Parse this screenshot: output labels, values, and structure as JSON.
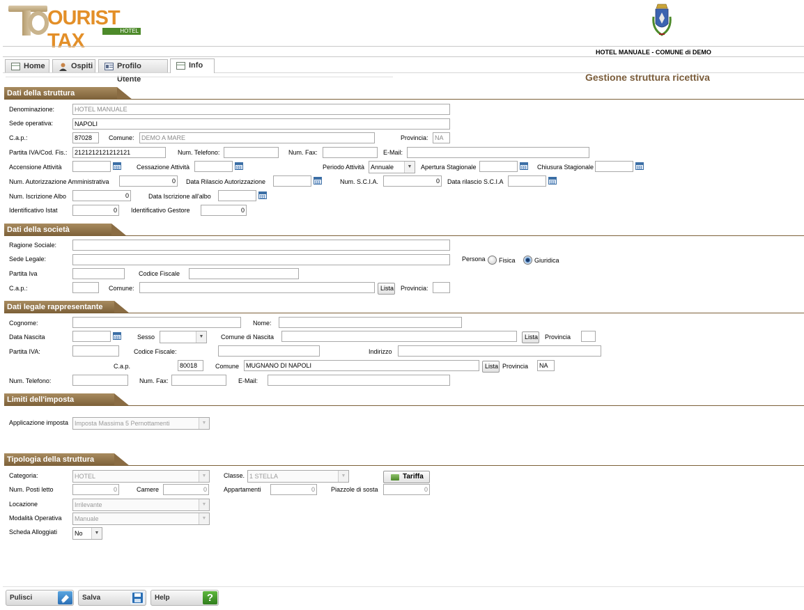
{
  "logo": {
    "text": "OURIST TAX",
    "letter": "T",
    "sub": "HOTEL"
  },
  "header": {
    "title": "HOTEL MANUALE - COMUNE di DEMO",
    "subtitle": "Gestione struttura ricettiva"
  },
  "tabs": [
    {
      "label": "Home",
      "icon": "home-icon"
    },
    {
      "label": "Ospiti",
      "icon": "user-icon"
    },
    {
      "label": "Profilo Utente",
      "icon": "id-card-icon"
    },
    {
      "label": "Info",
      "icon": "info-icon"
    }
  ],
  "colors": {
    "section": "#8a6c43",
    "accent": "#3b6ea5"
  },
  "struttura": {
    "title": "Dati della struttura",
    "denominazione_label": "Denominazione:",
    "denominazione": "HOTEL MANUALE",
    "sede_label": "Sede operativa:",
    "sede": "NAPOLI",
    "cap_label": "C.a.p.:",
    "cap": "87028",
    "comune_label": "Comune:",
    "comune": "DEMO A MARE",
    "provincia_label": "Provincia:",
    "provincia": "NA",
    "piva_label": "Partita IVA/Cod. Fis.:",
    "piva": "2121212121212121",
    "tel_label": "Num. Telefono:",
    "fax_label": "Num. Fax:",
    "email_label": "E-Mail:",
    "accensione_label": "Accensione Attività",
    "cessazione_label": "Cessazione Attività",
    "periodo_label": "Periodo Attività",
    "periodo": "Annuale",
    "apertura_label": "Apertura Stagionale",
    "chiusura_label": "Chiusura Stagionale",
    "aut_label": "Num. Autorizzazione Amministrativa",
    "aut": "0",
    "data_aut_label": "Data Rilascio Autorizzazione",
    "scia_label": "Num. S.C.I.A.",
    "scia": "0",
    "data_scia_label": "Data rilascio S.C.I.A",
    "albo_label": "Num. Iscrizione Albo",
    "albo": "0",
    "data_albo_label": "Data Iscrizione all'albo",
    "istat_label": "Identificativo Istat",
    "istat": "0",
    "gestore_label": "Identificativo Gestore",
    "gestore": "0"
  },
  "societa": {
    "title": "Dati della società",
    "ragione_label": "Ragione Sociale:",
    "sede_label": "Sede Legale:",
    "persona_label": "Persona",
    "fisica_label": "Fisica",
    "giuridica_label": "Giuridica",
    "piva_label": "Partita Iva",
    "cf_label": "Codice Fiscale",
    "cap_label": "C.a.p.:",
    "comune_label": "Comune:",
    "lista_label": "Lista",
    "provincia_label": "Provincia:"
  },
  "legale": {
    "title": "Dati legale rappresentante",
    "cognome_label": "Cognome:",
    "nome_label": "Nome:",
    "nascita_label": "Data Nascita",
    "sesso_label": "Sesso",
    "comune_nascita_label": "Comune di Nascita",
    "lista_label": "Lista",
    "provincia_label": "Provincia",
    "piva_label": "Partita IVA:",
    "cf_label": "Codice Fiscale:",
    "indirizzo_label": "Indirizzo",
    "cap_label": "C.a.p.",
    "cap": "80018",
    "comune_label": "Comune",
    "comune": "MUGNANO DI NAPOLI",
    "provincia2_label": "Provincia",
    "provincia2": "NA",
    "tel_label": "Num. Telefono:",
    "fax_label": "Num. Fax:",
    "email_label": "E-Mail:"
  },
  "limiti": {
    "title": "Limiti dell'imposta",
    "applicazione_label": "Applicazione imposta",
    "applicazione": "Imposta Massima 5 Pernottamenti"
  },
  "tipologia": {
    "title": "Tipologia della struttura",
    "categoria_label": "Categoria:",
    "categoria": "HOTEL",
    "classe_label": "Classe.",
    "classe": "1 STELLA",
    "tariffa_label": "Tariffa",
    "posti_label": "Num. Posti letto",
    "posti": "0",
    "camere_label": "Camere",
    "camere": "0",
    "appartamenti_label": "Appartamenti",
    "appartamenti": "0",
    "piazzole_label": "Piazzole di sosta",
    "piazzole": "0",
    "locazione_label": "Locazione",
    "locazione": "Irrilevante",
    "modalita_label": "Modalità Operativa",
    "modalita": "Manuale",
    "scheda_label": "Scheda Alloggiati",
    "scheda": "No"
  },
  "footer": {
    "pulisci": "Pulisci",
    "salva": "Salva",
    "help": "Help"
  }
}
